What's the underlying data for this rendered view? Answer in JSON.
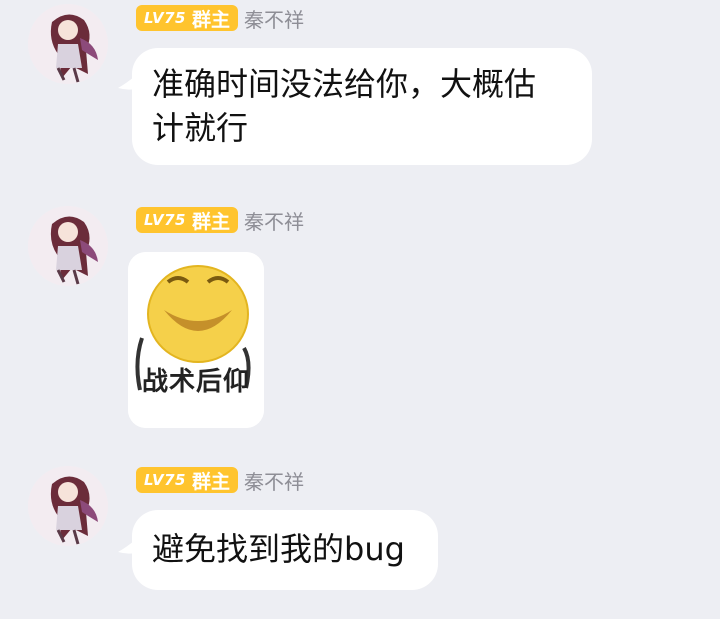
{
  "messages": [
    {
      "level": "LV75",
      "role": "群主",
      "sender": "秦不祥",
      "text_line1": "准确时间没法给你，大概估",
      "text_line2": "计就行"
    },
    {
      "level": "LV75",
      "role": "群主",
      "sender": "秦不祥",
      "sticker_caption": "战术后仰",
      "sticker_icon": "laughing-face-sticker"
    },
    {
      "level": "LV75",
      "role": "群主",
      "sender": "秦不祥",
      "text": "避免找到我的bug"
    }
  ],
  "colors": {
    "background": "#edeef3",
    "badge": "#ffc42e",
    "bubble": "#ffffff",
    "sender": "#8e8e96"
  }
}
